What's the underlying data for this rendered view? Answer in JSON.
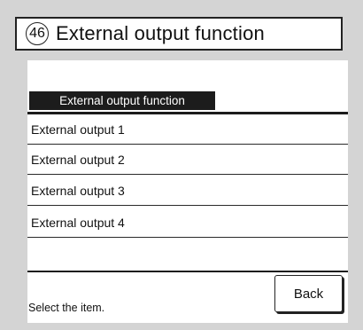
{
  "header": {
    "number": "46",
    "title": "External output function"
  },
  "section": {
    "tab_label": "External output function"
  },
  "items": [
    {
      "label": "External output 1"
    },
    {
      "label": "External output 2"
    },
    {
      "label": "External output 3"
    },
    {
      "label": "External output 4"
    }
  ],
  "footer": {
    "status": "Select the item.",
    "back_label": "Back"
  }
}
